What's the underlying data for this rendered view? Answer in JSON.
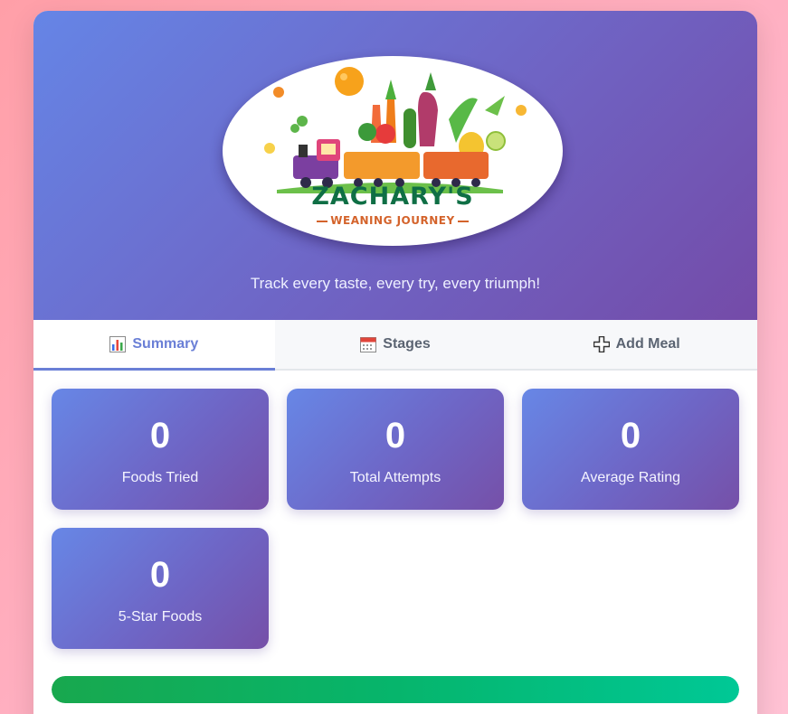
{
  "header": {
    "logo": {
      "title": "ZACHARY'S",
      "subtitle": "WEANING JOURNEY"
    },
    "tagline": "Track every taste, every try, every triumph!"
  },
  "tabs": [
    {
      "label": "Summary",
      "icon": "bar-chart-icon",
      "active": true
    },
    {
      "label": "Stages",
      "icon": "calendar-icon",
      "active": false
    },
    {
      "label": "Add Meal",
      "icon": "plus-icon",
      "active": false
    }
  ],
  "stats": [
    {
      "value": "0",
      "label": "Foods Tried"
    },
    {
      "value": "0",
      "label": "Total Attempts"
    },
    {
      "value": "0",
      "label": "Average Rating"
    },
    {
      "value": "0",
      "label": "5-Star Foods"
    }
  ],
  "progress": {
    "fraction": 1.0
  },
  "colors": {
    "accent": "#6a7fd6",
    "header_start": "#6585e6",
    "header_end": "#744ba8",
    "progress_start": "#18a84e",
    "progress_end": "#00c896",
    "page_background": "#ffb3c6"
  }
}
